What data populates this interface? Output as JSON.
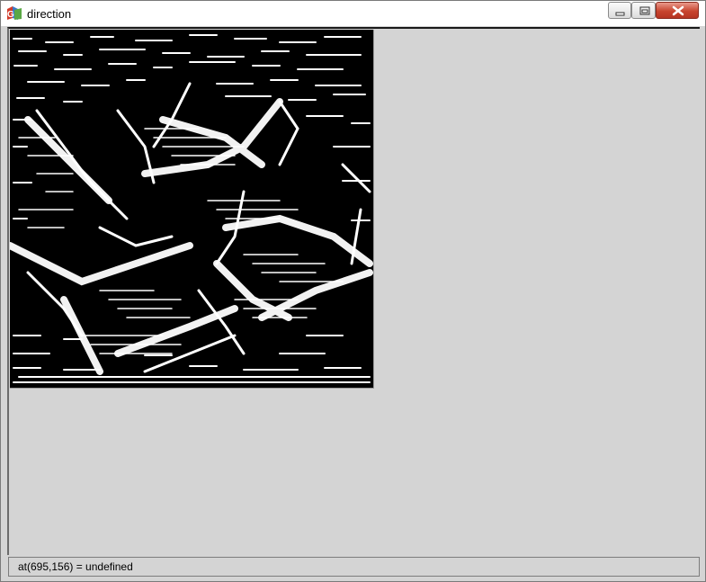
{
  "window": {
    "title": "direction",
    "app_icon": "gtk-logo-icon",
    "controls": [
      "minimize-icon",
      "maximize-icon",
      "close-icon"
    ]
  },
  "canvas": {
    "description_colors": {
      "foreground": "#ffffff",
      "background": "#000000"
    }
  },
  "status": {
    "text": "at(695,156) = undefined"
  }
}
